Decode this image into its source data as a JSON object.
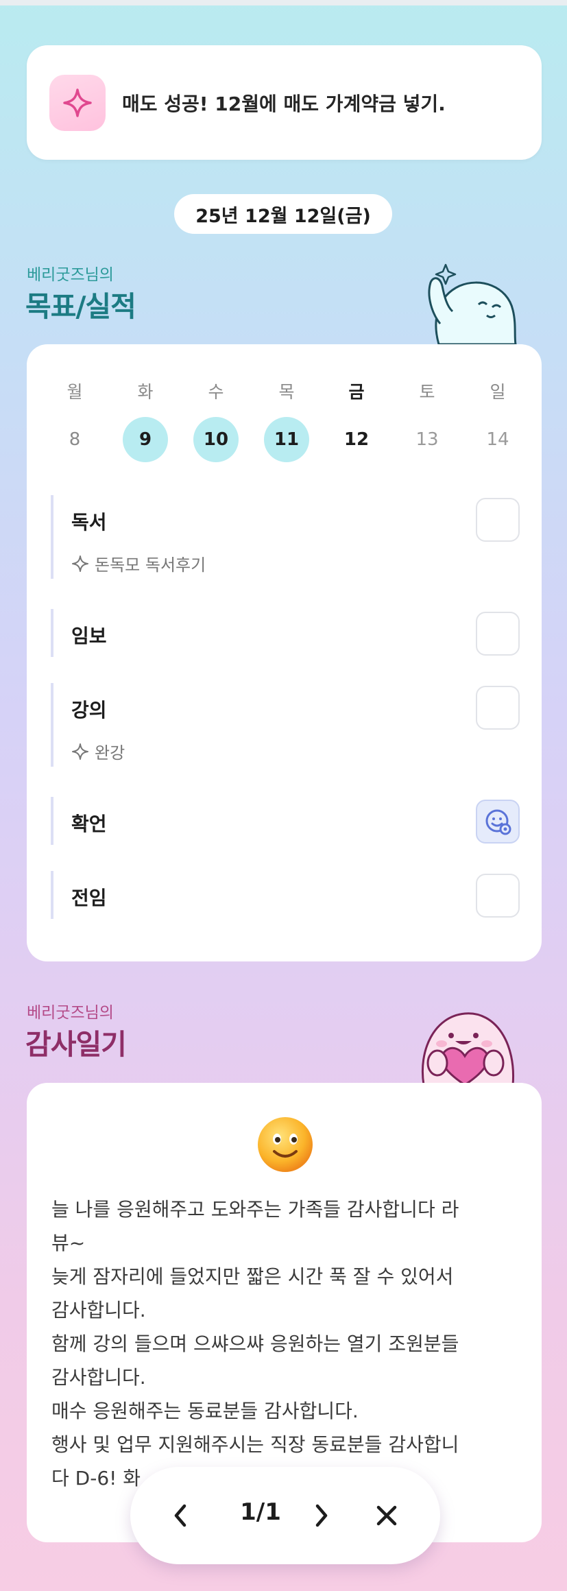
{
  "banner": {
    "icon": "sparkle-icon",
    "text": "매도 성공! 12월에 매도 가계약금 넣기."
  },
  "date": "25년 12월 12일(금)",
  "goals_section": {
    "subtitle": "베리굿즈님의",
    "title": "목표/실적"
  },
  "week": [
    {
      "name": "월",
      "num": "8",
      "state": "past"
    },
    {
      "name": "화",
      "num": "9",
      "state": "done"
    },
    {
      "name": "수",
      "num": "10",
      "state": "done"
    },
    {
      "name": "목",
      "num": "11",
      "state": "done"
    },
    {
      "name": "금",
      "num": "12",
      "state": "today"
    },
    {
      "name": "토",
      "num": "13",
      "state": "future"
    },
    {
      "name": "일",
      "num": "14",
      "state": "future"
    }
  ],
  "goals": [
    {
      "label": "독서",
      "note": "돈독모 독서후기",
      "checked": false
    },
    {
      "label": "임보",
      "note": "",
      "checked": false
    },
    {
      "label": "강의",
      "note": "완강",
      "checked": false
    },
    {
      "label": "확언",
      "note": "",
      "checked": true,
      "check_icon": "smiley-face-icon"
    },
    {
      "label": "전임",
      "note": "",
      "checked": false
    }
  ],
  "gratitude_section": {
    "subtitle": "베리굿즈님의",
    "title": "감사일기"
  },
  "gratitude": {
    "emoji": "smiling-face-emoji",
    "lines": [
      "늘 나를 응원해주고 도와주는 가족들 감사합니다 라",
      "뷰~",
      "늦게 잠자리에 들었지만 짧은 시간 푹 잘 수 있어서",
      "감사합니다.",
      "함께 강의 들으며 으쌰으쌰 응원하는 열기 조원분들",
      "감사합니다.",
      "매수 응원해주는 동료분들 감사합니다.",
      "행사 및 업무 지원해주시는 직장 동료분들 감사합니",
      "다 D-6! 화"
    ]
  },
  "pager": {
    "count": "1/1",
    "prev_icon": "chevron-left-icon",
    "next_icon": "chevron-right-icon",
    "close_icon": "close-icon"
  },
  "colors": {
    "teal_title": "#1c7b83",
    "pink_title": "#8e2e67",
    "done_day": "#b8ecf1"
  }
}
